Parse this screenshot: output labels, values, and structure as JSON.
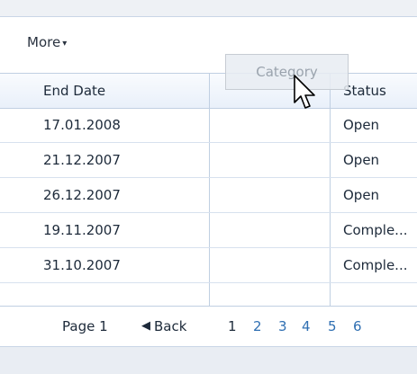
{
  "toolbar": {
    "more_label": "More"
  },
  "columns": {
    "end_date": "End Date",
    "status": "Status"
  },
  "drag": {
    "category_label": "Category"
  },
  "rows": [
    {
      "end_date": "17.01.2008",
      "status": "Open"
    },
    {
      "end_date": "21.12.2007",
      "status": "Open"
    },
    {
      "end_date": "26.12.2007",
      "status": "Open"
    },
    {
      "end_date": "19.11.2007",
      "status": "Comple..."
    },
    {
      "end_date": "31.10.2007",
      "status": "Comple..."
    }
  ],
  "pager": {
    "page_label": "Page 1",
    "back_label": "Back",
    "pages": [
      "1",
      "2",
      "3",
      "4",
      "5",
      "6"
    ]
  },
  "colors": {
    "link": "#2f6fb2",
    "border": "#c0cfe2"
  }
}
